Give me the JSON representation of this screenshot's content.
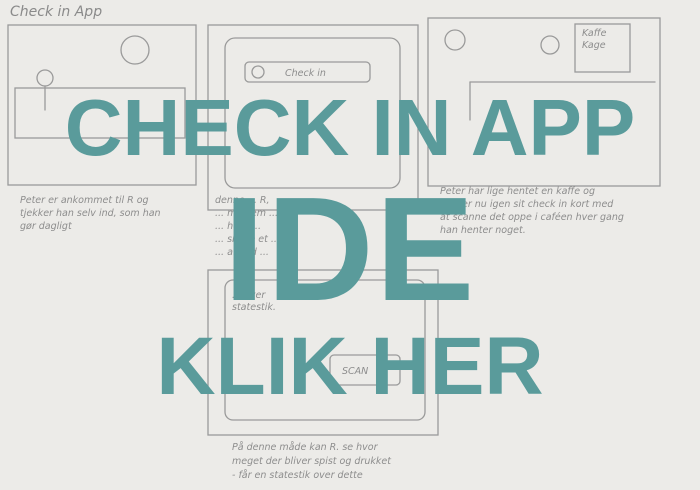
{
  "sketch": {
    "app_label": "Check in App",
    "panel1_caption": [
      "Peter er ankommet til R og",
      "tjekker han selv ind, som han",
      "gør dagligt"
    ],
    "panel2_screen": "Check in",
    "panel2_caption": [
      "denne ... R,",
      "... medlem ... der",
      "... her d...",
      "... skabe et ...",
      "... afsted ..."
    ],
    "panel3_menu": [
      "Kaffe",
      "Kage"
    ],
    "panel3_caption": [
      "Peter har lige hentet en kaffe og",
      "bruger nu igen sit check in kort med",
      "at scanne det oppe i caféen hver gang",
      "han henter noget."
    ],
    "panel4_screen": "SCAN",
    "panel4_note": [
      "... over",
      "statestik."
    ],
    "panel4_caption": [
      "På denne måde kan R. se hvor",
      "meget der bliver spist og drukket",
      "- får en statestik over dette"
    ]
  },
  "overlay": {
    "headline": "CHECK IN APP",
    "idea": "IDE",
    "cta": "KLIK HER"
  },
  "colors": {
    "accent": "#5a9b9b",
    "background": "#ecebe8",
    "pencil": "#8d8d8d"
  }
}
